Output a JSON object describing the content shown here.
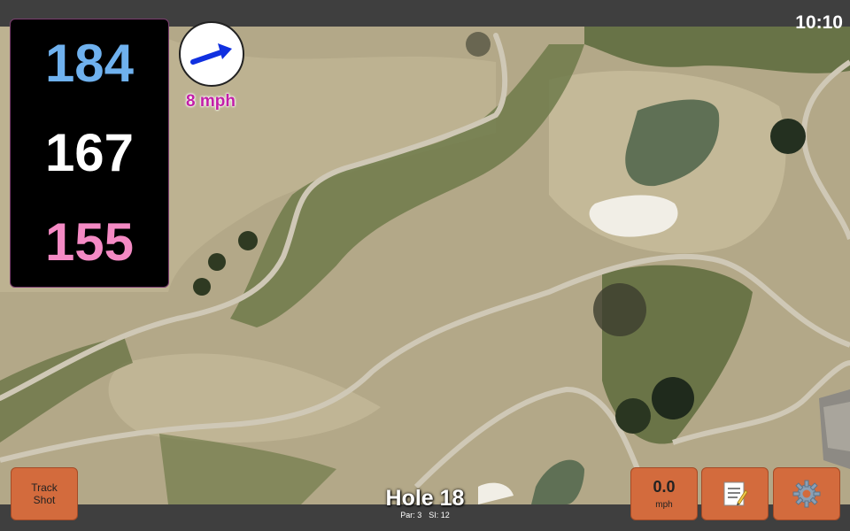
{
  "clock": "10:10",
  "distances": {
    "back": "184",
    "middle": "167",
    "front": "155",
    "colors": {
      "back": "#6fb1ee",
      "middle": "#ffffff",
      "front": "#f48ac4"
    }
  },
  "wind": {
    "label": "8 mph",
    "arrow_icon": "arrow-right-icon"
  },
  "buttons": {
    "track_shot": "Track\nShot",
    "speed_value": "0.0",
    "speed_unit": "mph",
    "notes_icon": "notepad-icon",
    "settings_icon": "gear-icon"
  },
  "hole": {
    "title": "Hole 18",
    "par": "Par: 3",
    "si": "SI: 12"
  },
  "colors": {
    "accent": "#d36b3d",
    "wind_text": "#c21ea7",
    "panel": "#000000",
    "bar": "#3f3f3f"
  }
}
